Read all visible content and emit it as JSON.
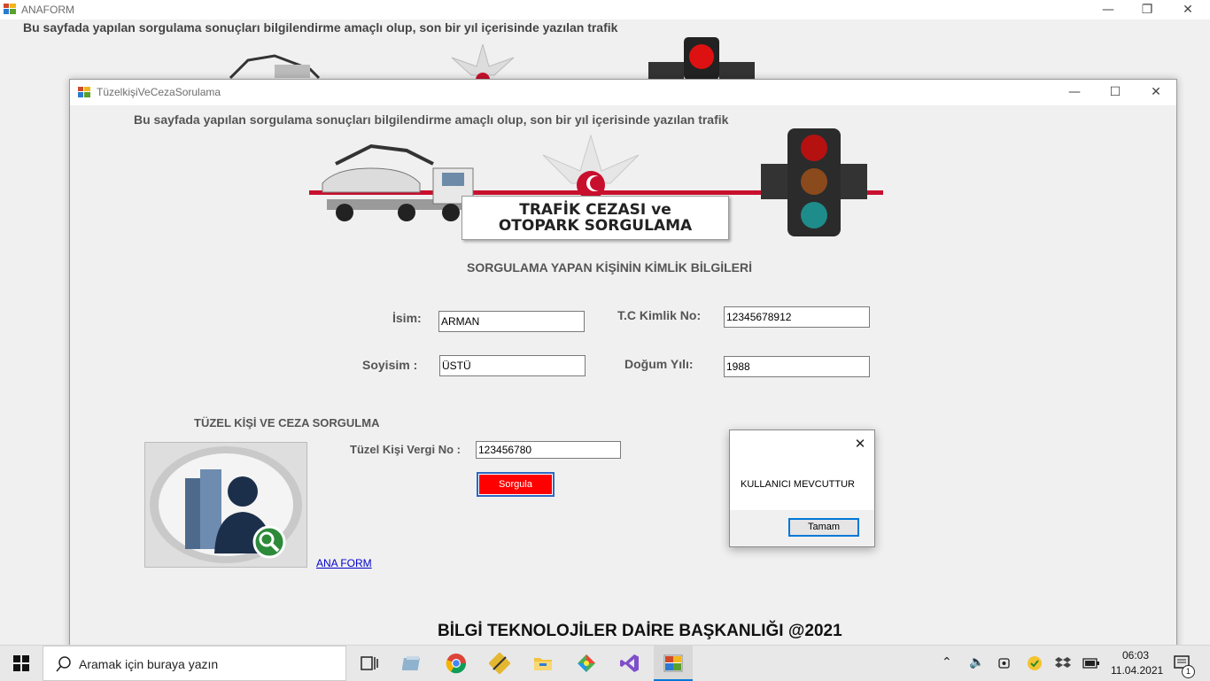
{
  "background_window": {
    "title": "ANAFORM",
    "info_text": "Bu sayfada yapılan sorgulama sonuçları bilgilendirme amaçlı olup, son bir yıl içerisinde yazılan trafik"
  },
  "window": {
    "title": "TüzelkişiVeCezaSorulama",
    "info_text": "Bu sayfada yapılan sorgulama sonuçları bilgilendirme amaçlı olup, son bir yıl içerisinde yazılan trafik",
    "banner": {
      "line1": "TRAFİK CEZASI ve",
      "line2": "OTOPARK SORGULAMA"
    },
    "section_title": "SORGULAMA YAPAN KİŞİNİN KİMLİK BİLGİLERİ",
    "fields": {
      "isim_label": "İsim:",
      "isim_value": "ARMAN",
      "tc_label": "T.C Kimlik No:",
      "tc_value": "12345678912",
      "soyisim_label": "Soyisim :",
      "soyisim_value": "ÜSTÜ",
      "dogum_label": "Doğum Yılı:",
      "dogum_value": "1988"
    },
    "tuzel_section_title": "TÜZEL KİŞİ VE CEZA SORGULMA",
    "vergi_label": "Tüzel Kişi Vergi No :",
    "vergi_value": "123456780",
    "query_button": "Sorgula",
    "ana_form_link": "ANA FORM",
    "footer": "BİLGİ TEKNOLOJİLER DAİRE BAŞKANLIĞI @2021"
  },
  "dialog": {
    "message": "KULLANICI MEVCUTTUR",
    "ok_button": "Tamam"
  },
  "taskbar": {
    "search_placeholder": "Aramak için buraya yazın",
    "time": "06:03",
    "date": "11.04.2021",
    "notification_count": "1"
  },
  "colors": {
    "query_button_bg": "#ff0000",
    "banner_red": "#c8102e",
    "link": "#0000cc"
  }
}
